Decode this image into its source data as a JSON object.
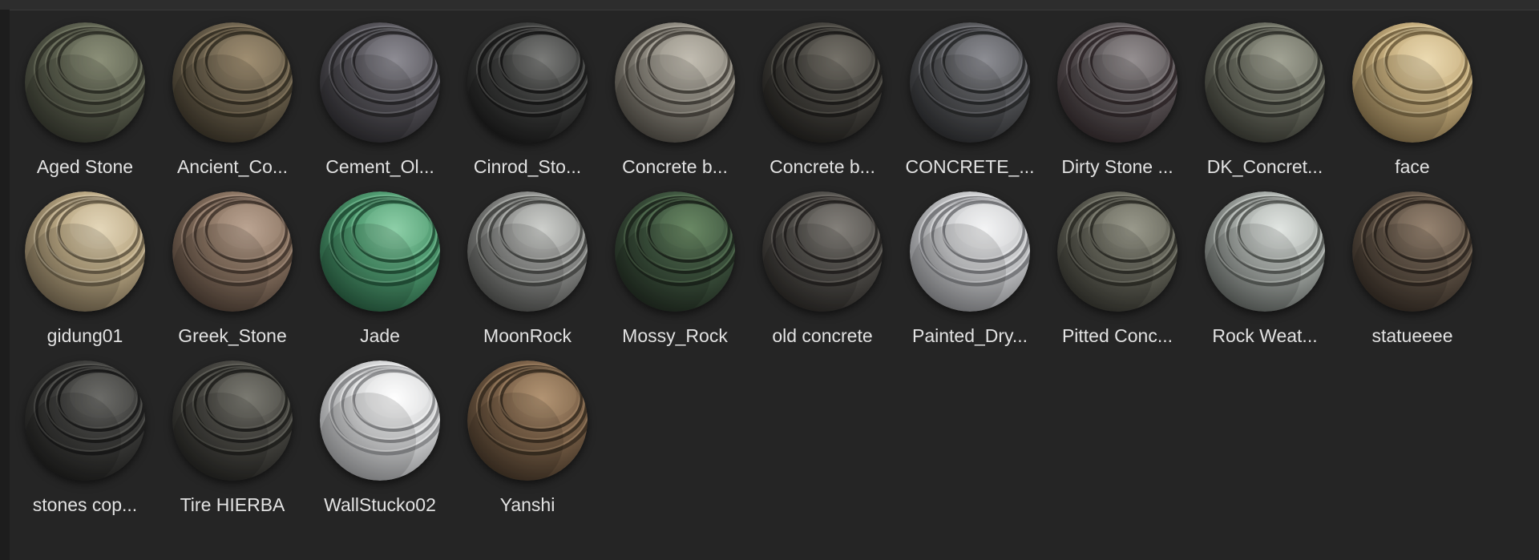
{
  "materials": [
    {
      "name": "Aged Stone",
      "icon": "material-sphere-icon",
      "base": "#5d6150",
      "light": "#8c9079",
      "dark": "#2b2d25"
    },
    {
      "name": "Ancient_Co...",
      "icon": "material-sphere-icon",
      "base": "#6f6450",
      "light": "#a08f72",
      "dark": "#2f2a20"
    },
    {
      "name": "Cement_Ol...",
      "icon": "material-sphere-icon",
      "base": "#56545a",
      "light": "#8f8d94",
      "dark": "#242326"
    },
    {
      "name": "Cinrod_Sto...",
      "icon": "material-sphere-icon",
      "base": "#3d3e3d",
      "light": "#7c7d7a",
      "dark": "#151515"
    },
    {
      "name": "Concrete b...",
      "icon": "material-sphere-icon",
      "base": "#8f8b81",
      "light": "#c3beb3",
      "dark": "#3f3c36"
    },
    {
      "name": "Concrete b...",
      "icon": "material-sphere-icon",
      "base": "#46443f",
      "light": "#76736b",
      "dark": "#1a1917"
    },
    {
      "name": "CONCRETE_...",
      "icon": "material-sphere-icon",
      "base": "#56575a",
      "light": "#8e8f94",
      "dark": "#232426"
    },
    {
      "name": "Dirty Stone ...",
      "icon": "material-sphere-icon",
      "base": "#5c5759",
      "light": "#969092",
      "dark": "#2a2224"
    },
    {
      "name": "DK_Concret...",
      "icon": "material-sphere-icon",
      "base": "#6c6e62",
      "light": "#a2a495",
      "dark": "#2e2f29"
    },
    {
      "name": "face",
      "icon": "material-sphere-icon",
      "base": "#c5ad7d",
      "light": "#ecdbb2",
      "dark": "#6b5a3b"
    },
    {
      "name": "gidung01",
      "icon": "material-sphere-icon",
      "base": "#b9a783",
      "light": "#e5d8ba",
      "dark": "#5e5340"
    },
    {
      "name": "Greek_Stone",
      "icon": "material-sphere-icon",
      "base": "#8a7462",
      "light": "#bca593",
      "dark": "#3e322a"
    },
    {
      "name": "Jade",
      "icon": "material-sphere-icon",
      "base": "#4f9a70",
      "light": "#8fd0a9",
      "dark": "#1f4a33"
    },
    {
      "name": "MoonRock",
      "icon": "material-sphere-icon",
      "base": "#8d8e8c",
      "light": "#cfd0cd",
      "dark": "#3e3f3d"
    },
    {
      "name": "Mossy_Rock",
      "icon": "material-sphere-icon",
      "base": "#3f5640",
      "light": "#6b8a65",
      "dark": "#1a221a"
    },
    {
      "name": "old concrete",
      "icon": "material-sphere-icon",
      "base": "#52504c",
      "light": "#84817b",
      "dark": "#211f1d"
    },
    {
      "name": "Painted_Dry...",
      "icon": "material-sphere-icon",
      "base": "#c9cacc",
      "light": "#f4f5f6",
      "dark": "#6f7073"
    },
    {
      "name": "Pitted Conc...",
      "icon": "material-sphere-icon",
      "base": "#65655a",
      "light": "#9a9a8c",
      "dark": "#2a2a25"
    },
    {
      "name": "Rock Weat...",
      "icon": "material-sphere-icon",
      "base": "#a7aca8",
      "light": "#e2e6e3",
      "dark": "#4d514e"
    },
    {
      "name": "statueeee",
      "icon": "material-sphere-icon",
      "base": "#615447",
      "light": "#978471",
      "dark": "#2a231d"
    },
    {
      "name": "stones cop...",
      "icon": "material-sphere-icon",
      "base": "#3e3e3c",
      "light": "#6c6c69",
      "dark": "#181817"
    },
    {
      "name": "Tire HIERBA",
      "icon": "material-sphere-icon",
      "base": "#4a4944",
      "light": "#7b7a72",
      "dark": "#1c1c1a"
    },
    {
      "name": "WallStucko02",
      "icon": "material-sphere-icon",
      "base": "#d6d7d8",
      "light": "#ffffff",
      "dark": "#7f8082"
    },
    {
      "name": "Yanshi",
      "icon": "material-sphere-icon",
      "base": "#7c6249",
      "light": "#b39474",
      "dark": "#352a1f"
    }
  ]
}
